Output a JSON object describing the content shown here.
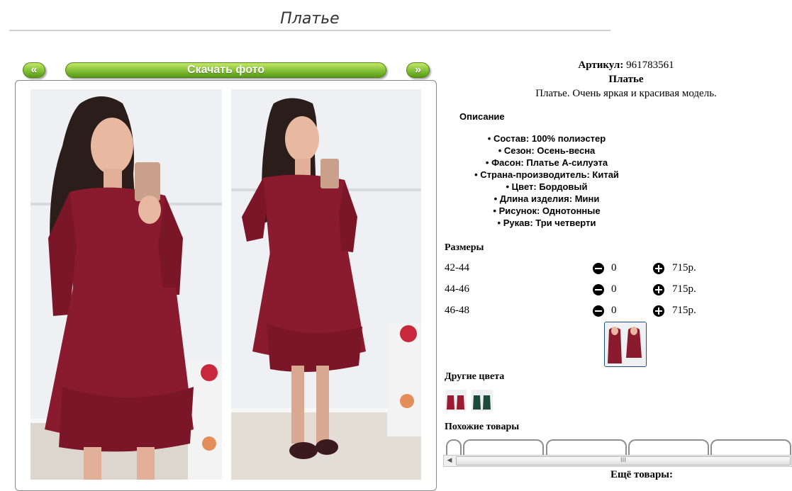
{
  "page": {
    "title": "Платье"
  },
  "photo_nav": {
    "prev_label": "«",
    "download_label": "Скачать фото",
    "next_label": "»"
  },
  "product": {
    "article_label": "Артикул:",
    "article_value": "961783561",
    "name": "Платье",
    "short_description": "Платье. Очень яркая и красивая модель.",
    "description_heading": "Описание",
    "specs": [
      "Состав: 100% полиэстер",
      "Сезон: Осень-весна",
      "Фасон: Платье А-силуэта",
      "Страна-производитель: Китай",
      "Цвет: Бордовый",
      "Длина изделия: Мини",
      "Рисунок: Однотонные",
      "Рукав: Три четверти"
    ],
    "accent_color": "#8a1a2e"
  },
  "sizes": {
    "heading": "Размеры",
    "rows": [
      {
        "size": "42-44",
        "qty": "0",
        "price": "715р."
      },
      {
        "size": "44-46",
        "qty": "0",
        "price": "715р."
      },
      {
        "size": "46-48",
        "qty": "0",
        "price": "715р."
      }
    ]
  },
  "other_colors": {
    "heading": "Другие цвета",
    "swatches": [
      "#9b1b30",
      "#1f4a3a"
    ]
  },
  "similar": {
    "heading": "Похожие товары"
  },
  "more": {
    "heading": "Ещё товары:"
  },
  "scrollbar": {
    "left_arrow": "◀",
    "grip": "III"
  },
  "colors": {
    "button_green": "#8cc63f",
    "dress": "#8a1a2e"
  }
}
